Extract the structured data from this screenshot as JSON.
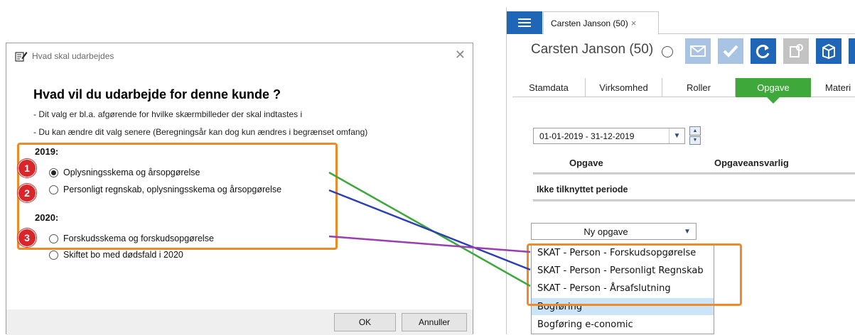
{
  "dialog": {
    "title": "Hvad skal udarbejdes",
    "heading": "Hvad vil du udarbejde for denne kunde ?",
    "info_line1": "- Dit valg er bl.a. afgørende for hvilke skærmbilleder der skal indtastes i",
    "info_line2": "- Du kan ændre dit valg senere (Beregningsår kan dog kun ændres i begrænset omfang)",
    "year_2019": "2019:",
    "year_2020": "2020:",
    "options": [
      {
        "label": "Oplysningsskema og årsopgørelse",
        "selected": true
      },
      {
        "label": "Personligt regnskab, oplysningsskema og årsopgørelse",
        "selected": false
      },
      {
        "label": "Forskudsskema og forskudsopgørelse",
        "selected": false
      },
      {
        "label": "Skiftet bo med dødsfald i 2020",
        "selected": false
      }
    ],
    "badges": [
      "1",
      "2",
      "3"
    ],
    "ok_label": "OK",
    "cancel_label": "Annuller"
  },
  "window": {
    "doc_tab": "Carsten Janson (50)",
    "doc_tab_close": "×",
    "customer_name": "Carsten Janson (50)",
    "nav_tabs": [
      "Stamdata",
      "Virksomhed",
      "Roller",
      "Opgave",
      "Materi"
    ],
    "active_tab": "Opgave",
    "period": "01-01-2019 - 31-12-2019",
    "col_task": "Opgave",
    "col_responsible": "Opgaveansvarlig",
    "unassigned_group": "Ikke tilknyttet periode",
    "new_task_label": "Ny opgave",
    "dropdown_items": [
      "SKAT - Person - Forskudsopgørelse",
      "SKAT - Person - Personligt Regnskab",
      "SKAT - Person - Årsafslutning",
      "Bogføring",
      "Bogføring e-conomic"
    ]
  },
  "colors": {
    "accent_blue": "#1f66b6",
    "active_tab_green": "#3fa83a",
    "highlight_orange": "#ef8a2a",
    "badge_red": "#d9262a",
    "line_green": "#3aa83a",
    "line_blue": "#2b3fb5",
    "line_purple": "#9a3db0"
  }
}
